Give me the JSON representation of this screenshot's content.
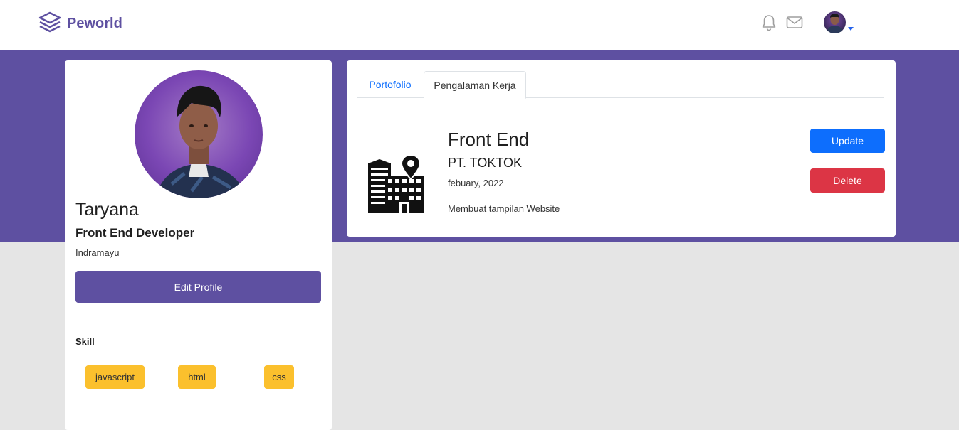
{
  "brand": {
    "name": "Peworld",
    "color": "#5e50a1"
  },
  "nav": {
    "icons": [
      "bell-icon",
      "mail-icon"
    ]
  },
  "profile": {
    "name": "Taryana",
    "job": "Front End Developer",
    "location": "Indramayu",
    "edit_label": "Edit Profile",
    "skill_heading": "Skill",
    "skills": [
      "javascript",
      "html",
      "css"
    ]
  },
  "tabs": [
    {
      "label": "Portofolio",
      "active": false
    },
    {
      "label": "Pengalaman Kerja",
      "active": true
    }
  ],
  "experience": {
    "position": "Front End",
    "company": "PT. TOKTOK",
    "date": "febuary, 2022",
    "description": "Membuat tampilan Website",
    "update_label": "Update",
    "delete_label": "Delete"
  },
  "colors": {
    "primary": "#5e50a1",
    "update": "#0d6efd",
    "delete": "#dc3545",
    "skill_badge": "#fbc02d"
  }
}
